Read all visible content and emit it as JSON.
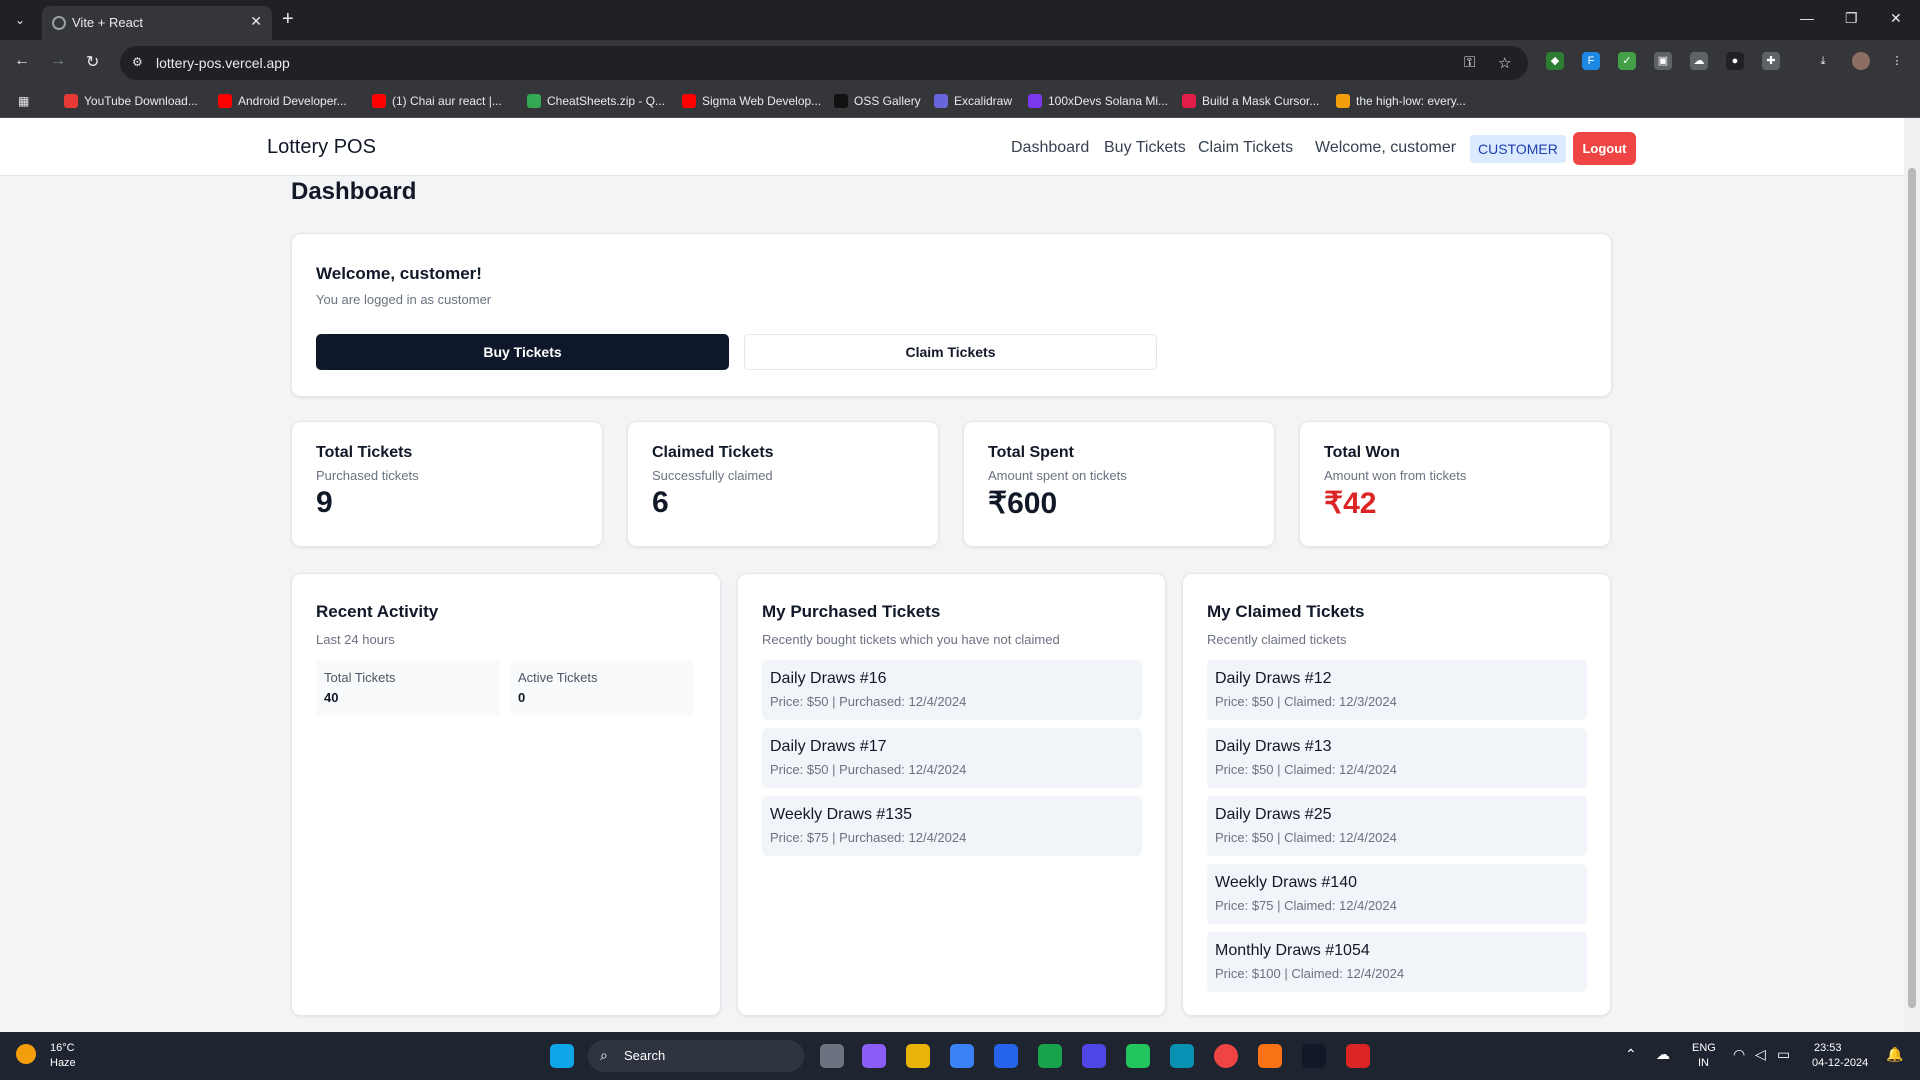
{
  "browser": {
    "tab_title": "Vite + React",
    "tab_close": "✕",
    "new_tab": "+",
    "url": "lottery-pos.vercel.app",
    "window_controls": [
      "—",
      "❐",
      "✕"
    ],
    "bookmarks": [
      {
        "label": "YouTube Download...",
        "color": "#e53935"
      },
      {
        "label": "Android Developer...",
        "color": "#ff0000"
      },
      {
        "label": "(1) Chai aur react |...",
        "color": "#ff0000"
      },
      {
        "label": "CheatSheets.zip - Q...",
        "color": "#34a853"
      },
      {
        "label": "Sigma Web Develop...",
        "color": "#ff0000"
      },
      {
        "label": "OSS Gallery",
        "color": "#111111"
      },
      {
        "label": "Excalidraw",
        "color": "#6965db"
      },
      {
        "label": "100xDevs Solana Mi...",
        "color": "#7c3aed"
      },
      {
        "label": "Build a Mask Cursor...",
        "color": "#e11d48"
      },
      {
        "label": "the high-low: every...",
        "color": "#f59e0b"
      }
    ]
  },
  "app": {
    "brand": "Lottery POS",
    "nav": {
      "dashboard": "Dashboard",
      "buy": "Buy Tickets",
      "claim": "Claim Tickets",
      "welcome": "Welcome, customer",
      "role": "CUSTOMER",
      "logout": "Logout"
    },
    "page_title": "Dashboard",
    "welcome_card": {
      "title": "Welcome, customer!",
      "subtitle": "You are logged in as customer",
      "buy_label": "Buy Tickets",
      "claim_label": "Claim Tickets"
    },
    "stats": [
      {
        "title": "Total Tickets",
        "subtitle": "Purchased tickets",
        "value": "9",
        "color": "#111827"
      },
      {
        "title": "Claimed Tickets",
        "subtitle": "Successfully claimed",
        "value": "6",
        "color": "#111827"
      },
      {
        "title": "Total Spent",
        "subtitle": "Amount spent on tickets",
        "value": "₹600",
        "color": "#111827"
      },
      {
        "title": "Total Won",
        "subtitle": "Amount won from tickets",
        "value": "₹42",
        "color": "#dc2626"
      }
    ],
    "recent_activity": {
      "title": "Recent Activity",
      "subtitle": "Last 24 hours",
      "items": [
        {
          "label": "Total Tickets",
          "value": "40"
        },
        {
          "label": "Active Tickets",
          "value": "0"
        }
      ]
    },
    "purchased": {
      "title": "My Purchased Tickets",
      "subtitle": "Recently bought tickets which you have not claimed",
      "items": [
        {
          "name": "Daily Draws #16",
          "info": "Price: $50 | Purchased: 12/4/2024"
        },
        {
          "name": "Daily Draws #17",
          "info": "Price: $50 | Purchased: 12/4/2024"
        },
        {
          "name": "Weekly Draws #135",
          "info": "Price: $75 | Purchased: 12/4/2024"
        }
      ]
    },
    "claimed": {
      "title": "My Claimed Tickets",
      "subtitle": "Recently claimed tickets",
      "items": [
        {
          "name": "Daily Draws #12",
          "info": "Price: $50 | Claimed: 12/3/2024"
        },
        {
          "name": "Daily Draws #13",
          "info": "Price: $50 | Claimed: 12/4/2024"
        },
        {
          "name": "Daily Draws #25",
          "info": "Price: $50 | Claimed: 12/4/2024"
        },
        {
          "name": "Weekly Draws #140",
          "info": "Price: $75 | Claimed: 12/4/2024"
        },
        {
          "name": "Monthly Draws #1054",
          "info": "Price: $100 | Claimed: 12/4/2024"
        }
      ]
    }
  },
  "taskbar": {
    "weather_temp": "16°C",
    "weather_desc": "Haze",
    "search_label": "Search",
    "lang_line1": "ENG",
    "lang_line2": "IN",
    "time": "23:53",
    "date": "04-12-2024"
  }
}
